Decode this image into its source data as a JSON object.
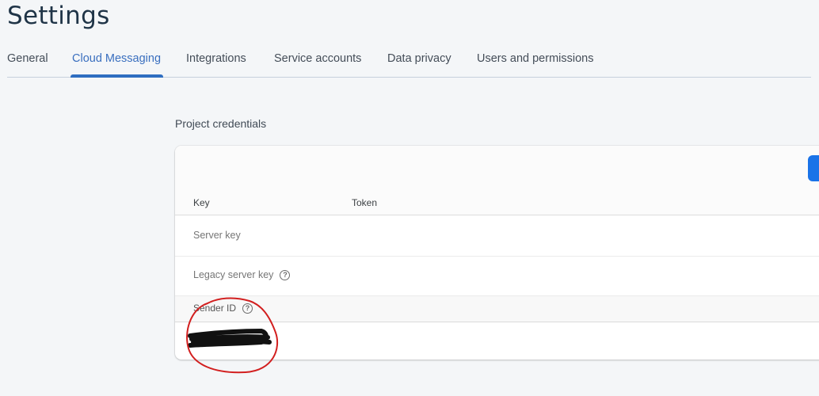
{
  "header": {
    "title": "Settings"
  },
  "tabs": [
    {
      "label": "General",
      "active": false
    },
    {
      "label": "Cloud Messaging",
      "active": true
    },
    {
      "label": "Integrations",
      "active": false
    },
    {
      "label": "Service accounts",
      "active": false
    },
    {
      "label": "Data privacy",
      "active": false
    },
    {
      "label": "Users and permissions",
      "active": false
    }
  ],
  "colors": {
    "accent": "#2f6ec1",
    "button": "#1a73e8",
    "annotation": "#d21f1f"
  },
  "credentials": {
    "section_title": "Project credentials",
    "columns": [
      "Key",
      "Token"
    ],
    "rows": [
      {
        "key": "Server key",
        "token": "",
        "help_icon": false
      },
      {
        "key": "Legacy server key",
        "token": "",
        "help_icon": true
      }
    ],
    "sender": {
      "label": "Sender ID",
      "value": "[redacted]",
      "help_icon": true
    }
  },
  "icons": {
    "help": "help-circle-icon"
  }
}
